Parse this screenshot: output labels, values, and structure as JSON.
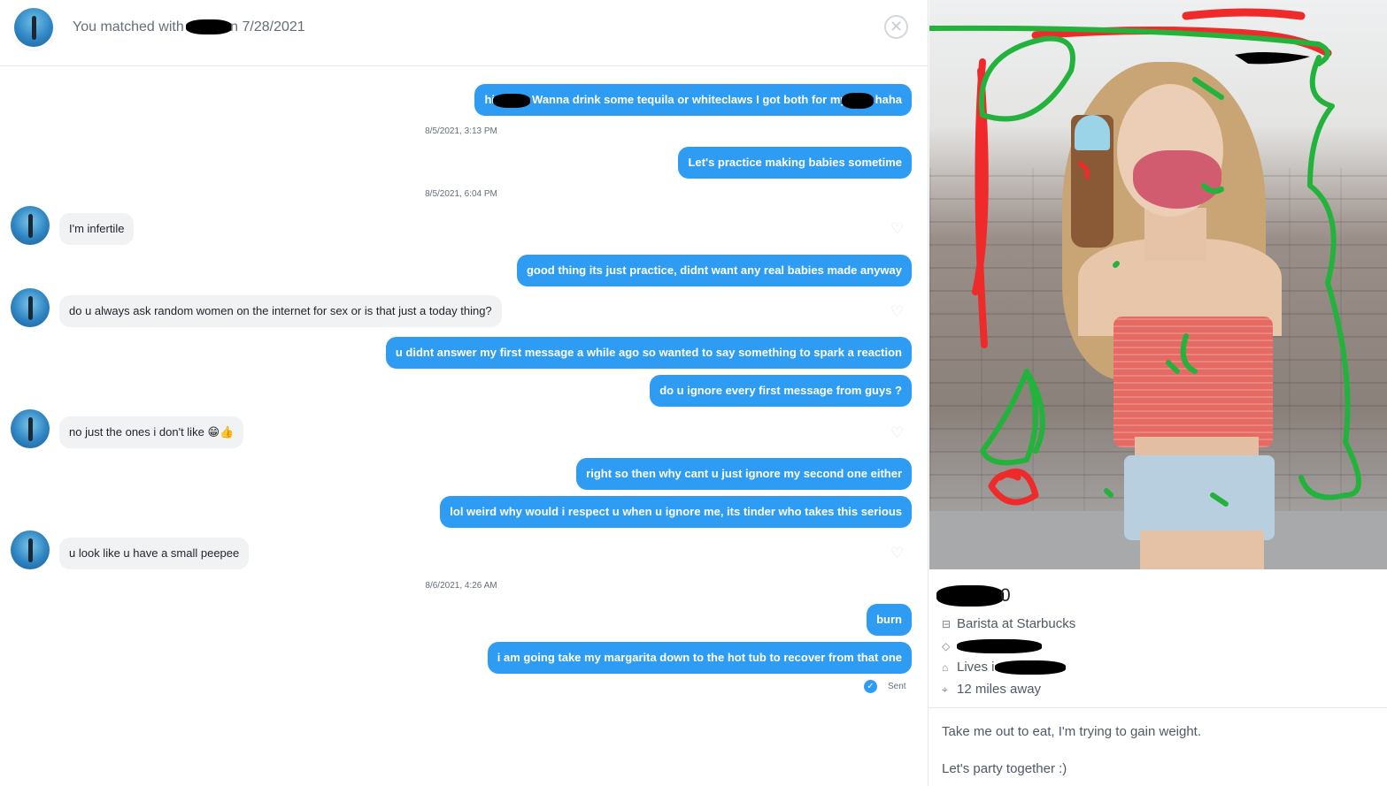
{
  "header": {
    "match_prefix": "You matched with",
    "match_suffix": "n 7/28/2021",
    "close_icon": "✕"
  },
  "conversation": {
    "messages": [
      {
        "dir": "out",
        "text_a": "hi",
        "text_b": "Wanna drink some tequila or whiteclaws I got both for my",
        "text_c": "haha"
      },
      {
        "dir": "out",
        "text": "Let's practice making babies sometime"
      },
      {
        "dir": "in",
        "text": "I'm infertile"
      },
      {
        "dir": "out",
        "text": "good thing its just practice, didnt want any real babies made anyway"
      },
      {
        "dir": "in",
        "text": "do u always ask random women on the internet for sex or is that just a today thing?"
      },
      {
        "dir": "out",
        "text": "u didnt answer my first message a while ago so wanted to say something to spark a reaction"
      },
      {
        "dir": "out",
        "text": "do u ignore every first message from guys ?"
      },
      {
        "dir": "in",
        "text": "no just the ones i don't like",
        "emoji": "😁👍"
      },
      {
        "dir": "out",
        "text": "right so then why cant u just ignore my second one either"
      },
      {
        "dir": "out",
        "text": "lol weird why would i respect u when u ignore me, its tinder who takes this serious"
      },
      {
        "dir": "in",
        "text": "u look like u have a small peepee"
      },
      {
        "dir": "out",
        "text": "burn"
      },
      {
        "dir": "out",
        "text": "i am going take my margarita down to the hot tub to recover from that one"
      }
    ],
    "timestamps": [
      "8/5/2021, 3:13 PM",
      "8/5/2021, 6:04 PM",
      "8/6/2021, 4:26 AM"
    ],
    "sent_label": "Sent",
    "sent_icon": "✓",
    "heart_icon": "♡"
  },
  "profile": {
    "age": "0",
    "job": "Barista at Starbucks",
    "lives_prefix": "Lives i",
    "distance": "12 miles away",
    "bio": "Take me out to eat, I'm trying to gain weight.\n\nLet's party together :)",
    "icons": {
      "job": "briefcase-icon",
      "school": "graduation-cap-icon",
      "home": "home-icon",
      "distance": "location-pin-icon"
    }
  },
  "colors": {
    "outgoing_bubble": "#2f9cf4",
    "incoming_bubble": "#f1f2f4",
    "drawing_red": "#ee2a2a",
    "drawing_green": "#23b33d"
  }
}
